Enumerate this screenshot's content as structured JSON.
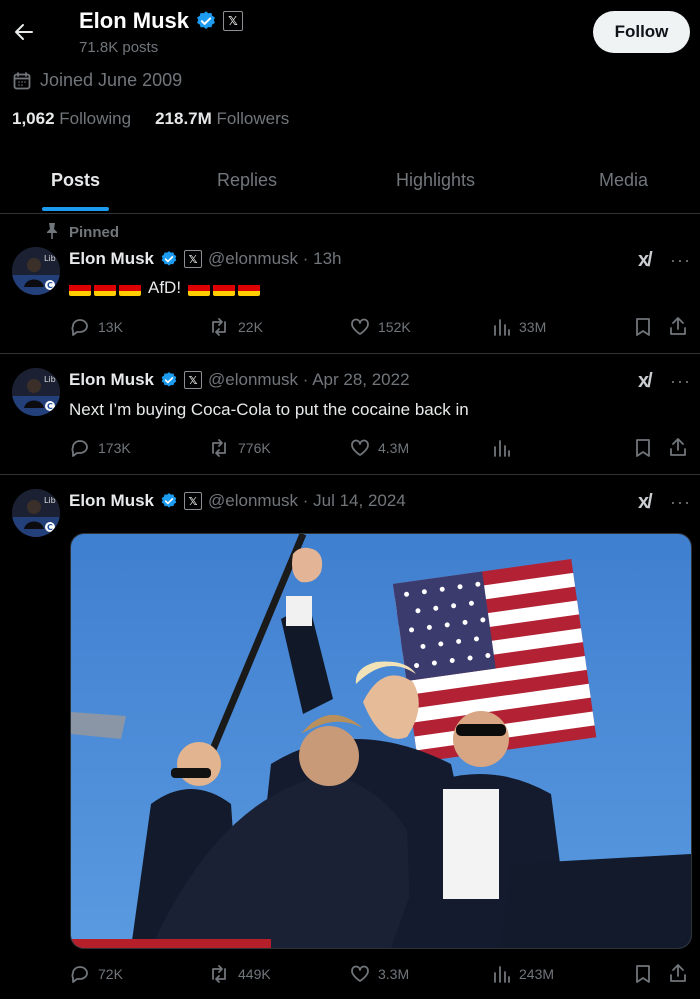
{
  "header": {
    "name": "Elon Musk",
    "posts_count": "71.8K posts",
    "follow_label": "Follow"
  },
  "profile": {
    "joined": "Joined June 2009",
    "following_count": "1,062",
    "following_label": "Following",
    "followers_count": "218.7M",
    "followers_label": "Followers"
  },
  "tabs": [
    {
      "label": "Posts"
    },
    {
      "label": "Replies"
    },
    {
      "label": "Highlights"
    },
    {
      "label": "Media"
    }
  ],
  "posts": [
    {
      "pinned_label": "Pinned",
      "name": "Elon Musk",
      "handle_time": "@elonmusk · 13h",
      "text": "AfD!",
      "replies": "13K",
      "reposts": "22K",
      "likes": "152K",
      "views": "33M"
    },
    {
      "name": "Elon Musk",
      "handle_time": "@elonmusk · Apr 28, 2022",
      "text": "Next I’m buying Coca-Cola to put the cocaine back in",
      "replies": "173K",
      "reposts": "776K",
      "likes": "4.3M"
    },
    {
      "name": "Elon Musk",
      "handle_time": "@elonmusk · Jul 14, 2024",
      "replies": "72K",
      "reposts": "449K",
      "likes": "3.3M",
      "views": "243M"
    }
  ],
  "icons": {
    "verified_color": "#1d9bf0",
    "accent": "#1d9bf0"
  }
}
